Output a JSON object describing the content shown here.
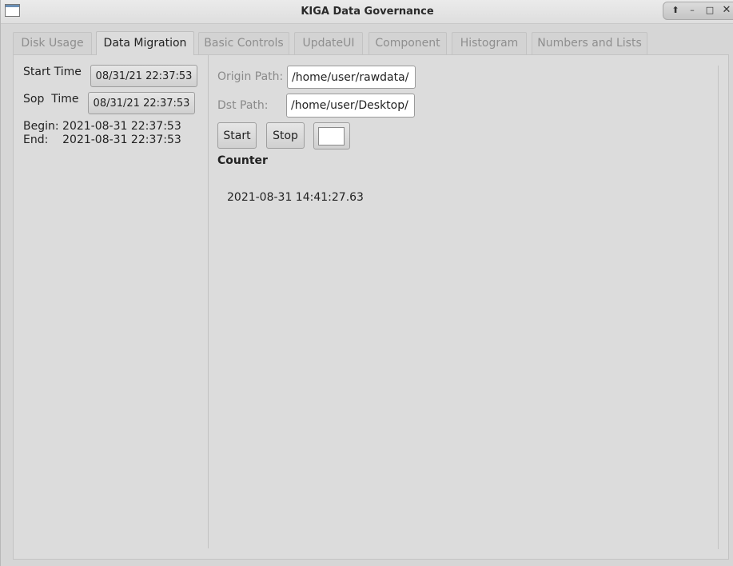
{
  "window": {
    "title": "KIGA Data Governance",
    "controls": [
      "up-icon",
      "minimize-icon",
      "maximize-icon",
      "close-icon"
    ]
  },
  "tabs": [
    {
      "label": "Disk Usage",
      "active": false
    },
    {
      "label": "Data Migration",
      "active": true
    },
    {
      "label": "Basic Controls",
      "active": false
    },
    {
      "label": "UpdateUI",
      "active": false
    },
    {
      "label": "Component",
      "active": false
    },
    {
      "label": "Histogram",
      "active": false
    },
    {
      "label": "Numbers and Lists",
      "active": false
    }
  ],
  "left": {
    "start_time_label": "Start Time",
    "start_time_value": "08/31/21 22:37:53",
    "stop_time_label": "Sop  Time",
    "stop_time_value": "08/31/21 22:37:53",
    "begin_text": "Begin: 2021-08-31 22:37:53",
    "end_text": "End:    2021-08-31 22:37:53"
  },
  "right": {
    "origin_label": "Origin Path:",
    "origin_value": "/home/user/rawdata/",
    "dst_label": "Dst Path:",
    "dst_value": "/home/user/Desktop/",
    "start_button": "Start",
    "stop_button": "Stop",
    "swatch_color": "#ffffff",
    "counter_title": "Counter",
    "counter_value": "2021-08-31 14:41:27.63"
  }
}
